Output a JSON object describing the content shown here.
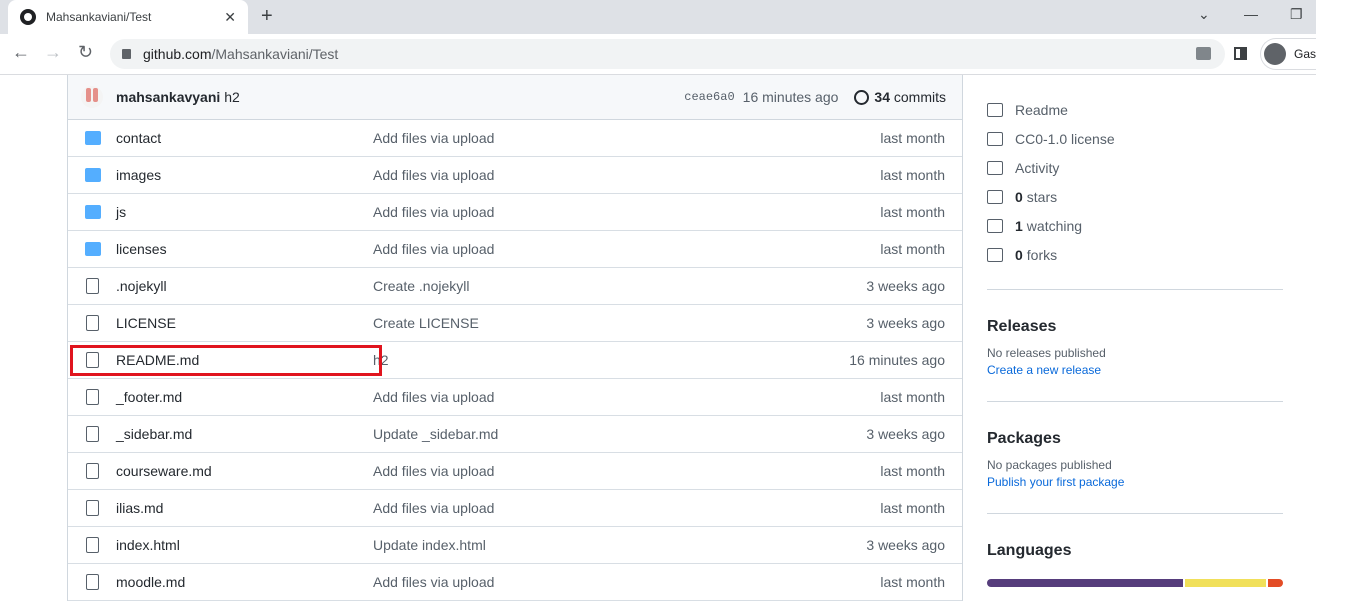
{
  "browser": {
    "tab_title": "Mahsankaviani/Test",
    "url_host": "github.com",
    "url_path": "/Mahsankaviani/Test",
    "profile": "Gast"
  },
  "commit": {
    "author": "mahsankavyani",
    "message": "h2",
    "sha": "ceae6a0",
    "time": "16 minutes ago",
    "count": "34",
    "count_label": "commits"
  },
  "files": [
    {
      "type": "folder",
      "name": "contact",
      "msg": "Add files via upload",
      "age": "last month"
    },
    {
      "type": "folder",
      "name": "images",
      "msg": "Add files via upload",
      "age": "last month"
    },
    {
      "type": "folder",
      "name": "js",
      "msg": "Add files via upload",
      "age": "last month"
    },
    {
      "type": "folder",
      "name": "licenses",
      "msg": "Add files via upload",
      "age": "last month"
    },
    {
      "type": "file",
      "name": ".nojekyll",
      "msg": "Create .nojekyll",
      "age": "3 weeks ago"
    },
    {
      "type": "file",
      "name": "LICENSE",
      "msg": "Create LICENSE",
      "age": "3 weeks ago"
    },
    {
      "type": "file",
      "name": "README.md",
      "msg": "h2",
      "age": "16 minutes ago",
      "highlighted": true
    },
    {
      "type": "file",
      "name": "_footer.md",
      "msg": "Add files via upload",
      "age": "last month"
    },
    {
      "type": "file",
      "name": "_sidebar.md",
      "msg": "Update _sidebar.md",
      "age": "3 weeks ago"
    },
    {
      "type": "file",
      "name": "courseware.md",
      "msg": "Add files via upload",
      "age": "last month"
    },
    {
      "type": "file",
      "name": "ilias.md",
      "msg": "Add files via upload",
      "age": "last month"
    },
    {
      "type": "file",
      "name": "index.html",
      "msg": "Update index.html",
      "age": "3 weeks ago"
    },
    {
      "type": "file",
      "name": "moodle.md",
      "msg": "Add files via upload",
      "age": "last month"
    }
  ],
  "about": [
    {
      "icon": "book-icon",
      "bold": "",
      "label": "Readme"
    },
    {
      "icon": "law-icon",
      "bold": "",
      "label": "CC0-1.0 license"
    },
    {
      "icon": "pulse-icon",
      "bold": "",
      "label": "Activity"
    },
    {
      "icon": "star-icon",
      "bold": "0",
      "label": "stars"
    },
    {
      "icon": "eye-icon",
      "bold": "1",
      "label": "watching"
    },
    {
      "icon": "fork-icon",
      "bold": "0",
      "label": "forks"
    }
  ],
  "releases": {
    "title": "Releases",
    "empty": "No releases published",
    "link": "Create a new release"
  },
  "packages": {
    "title": "Packages",
    "empty": "No packages published",
    "link": "Publish your first package"
  },
  "languages": {
    "title": "Languages",
    "bar": [
      {
        "color": "#563d7c",
        "share": 67
      },
      {
        "color": "#f1e05a",
        "share": 28
      },
      {
        "color": "#e34c26",
        "share": 5
      }
    ]
  }
}
